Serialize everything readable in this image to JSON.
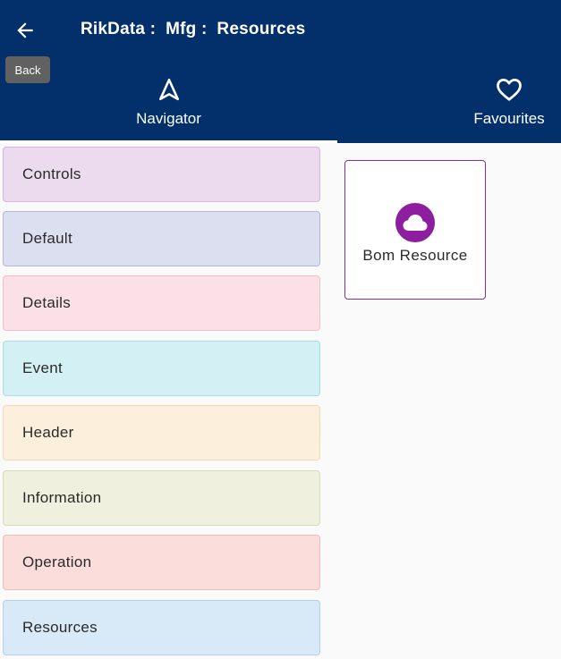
{
  "header": {
    "title": "RikData :  Mfg :  Resources",
    "back_tooltip": "Back",
    "background": "#03306b"
  },
  "tabs": [
    {
      "label": "Navigator",
      "icon": "navigation-arrow-icon",
      "selected": true
    },
    {
      "label": "Favourites",
      "icon": "heart-outline-icon",
      "selected": false
    }
  ],
  "categories": [
    {
      "label": "Controls",
      "bg": "#ecdaef",
      "border": "#d6b6de"
    },
    {
      "label": "Default",
      "bg": "#dcdff0",
      "border": "#b3b8d8"
    },
    {
      "label": "Details",
      "bg": "#fbe1e7",
      "border": "#f1c0cb"
    },
    {
      "label": "Event",
      "bg": "#d3f1f4",
      "border": "#a7dde3"
    },
    {
      "label": "Header",
      "bg": "#fcefdc",
      "border": "#f1d9b3"
    },
    {
      "label": "Information",
      "bg": "#eff0dd",
      "border": "#d6dcb7"
    },
    {
      "label": "Operation",
      "bg": "#fbdedc",
      "border": "#f1bcb6"
    },
    {
      "label": "Resources",
      "bg": "#d8e9f7",
      "border": "#b3d1ea"
    }
  ],
  "resource_card": {
    "label": "Bom Resource",
    "icon": "cloud-icon",
    "accent": "#8e1ea0"
  }
}
